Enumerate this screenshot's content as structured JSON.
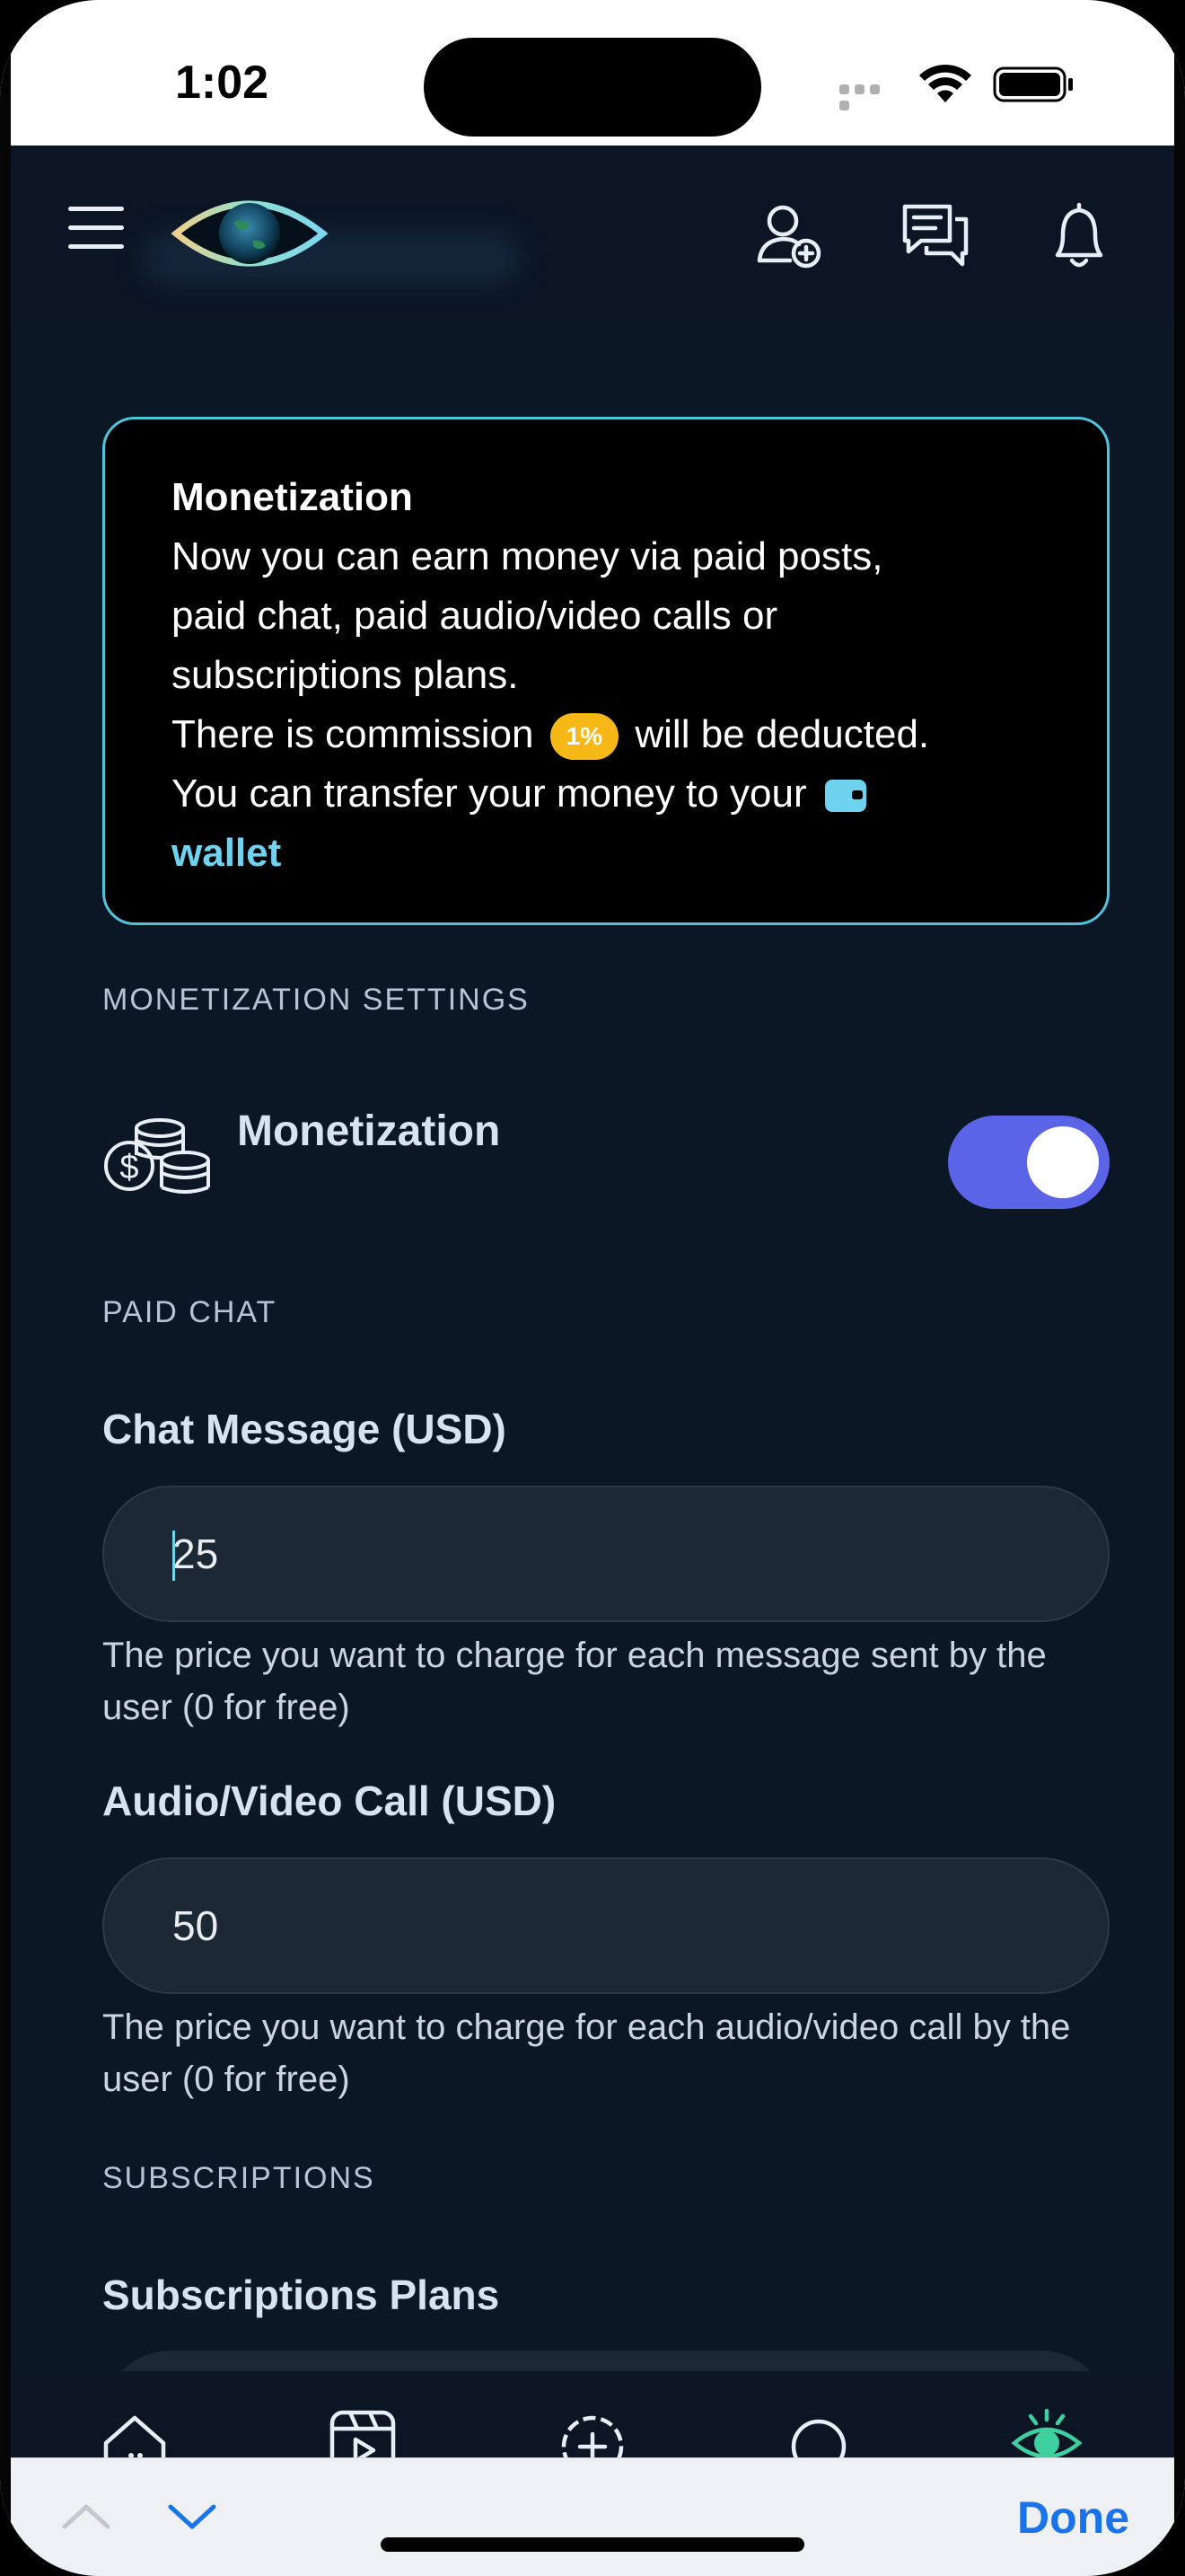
{
  "status_bar": {
    "time": "1:02"
  },
  "info_card": {
    "title": "Monetization",
    "line1": "Now you can earn money via paid posts,",
    "line2": "paid chat, paid audio/video calls or",
    "line3": "subscriptions plans.",
    "commission_before": "There is commission",
    "commission_badge": "1%",
    "commission_after": "will be deducted.",
    "transfer_text": "You can transfer your money to your",
    "wallet_link": "wallet"
  },
  "sections": {
    "monetization_settings": "MONETIZATION SETTINGS",
    "paid_chat": "PAID CHAT",
    "subscriptions": "SUBSCRIPTIONS"
  },
  "monetization_toggle": {
    "label": "Monetization",
    "enabled": true
  },
  "chat_message": {
    "label": "Chat Message (USD)",
    "value": "25",
    "help": "The price you want to charge for each message sent by the user (0 for free)"
  },
  "call": {
    "label": "Audio/Video Call (USD)",
    "value": "50",
    "help": "The price you want to charge for each audio/video call by the user (0 for free)"
  },
  "subscriptions_plans": {
    "label": "Subscriptions Plans"
  },
  "keyboard_bar": {
    "done_label": "Done"
  },
  "colors": {
    "accent": "#5b63e6",
    "link": "#6fd3ef",
    "badge": "#f5b817",
    "background": "#0c1726",
    "done": "#1a73e8"
  }
}
